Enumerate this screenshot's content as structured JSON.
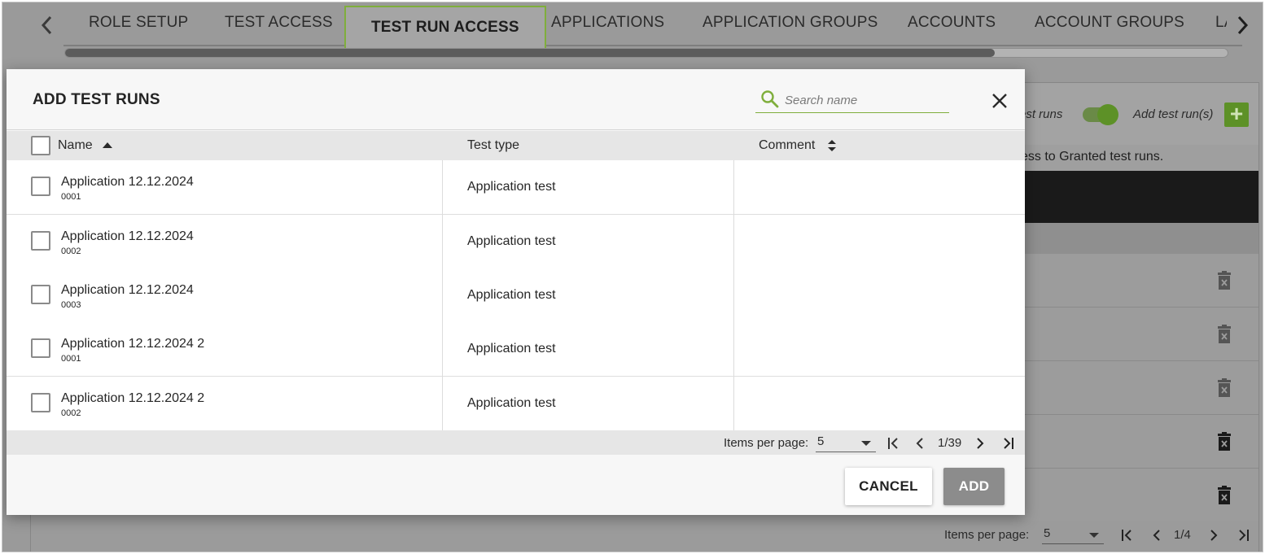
{
  "tabs": {
    "items": [
      "ROLE SETUP",
      "TEST ACCESS",
      "TEST RUN ACCESS",
      "APPLICATIONS",
      "APPLICATION GROUPS",
      "ACCOUNTS",
      "ACCOUNT GROUPS",
      "LA"
    ],
    "active": "TEST RUN ACCESS",
    "scroll_position_percent": 80
  },
  "background": {
    "toggle_label": "est runs",
    "add_label": "Add test run(s)",
    "add_icon": "+",
    "info_text": "ess to Granted test runs.",
    "pager": {
      "items_per_page_label": "Items per page:",
      "items_per_page": "5",
      "page_indicator": "1/4"
    }
  },
  "modal": {
    "title": "ADD TEST RUNS",
    "search": {
      "placeholder": "Search name",
      "value": ""
    },
    "columns": {
      "name": "Name",
      "test_type": "Test type",
      "comment": "Comment"
    },
    "rows": [
      {
        "name": "Application 12.12.2024",
        "number": "0001",
        "test_type": "Application test",
        "comment": ""
      },
      {
        "name": "Application 12.12.2024",
        "number": "0002",
        "test_type": "Application test",
        "comment": ""
      },
      {
        "name": "Application 12.12.2024",
        "number": "0003",
        "test_type": "Application test",
        "comment": ""
      },
      {
        "name": "Application 12.12.2024 2",
        "number": "0001",
        "test_type": "Application test",
        "comment": ""
      },
      {
        "name": "Application 12.12.2024 2",
        "number": "0002",
        "test_type": "Application test",
        "comment": ""
      }
    ],
    "pager": {
      "items_per_page_label": "Items per page:",
      "items_per_page": "5",
      "page_indicator": "1/39"
    },
    "buttons": {
      "cancel": "CANCEL",
      "add": "ADD"
    }
  },
  "colors": {
    "accent_green": "#7fae3c",
    "overlay_gray": "#9a9a9a",
    "add_button_disabled": "#8c8c8c"
  }
}
